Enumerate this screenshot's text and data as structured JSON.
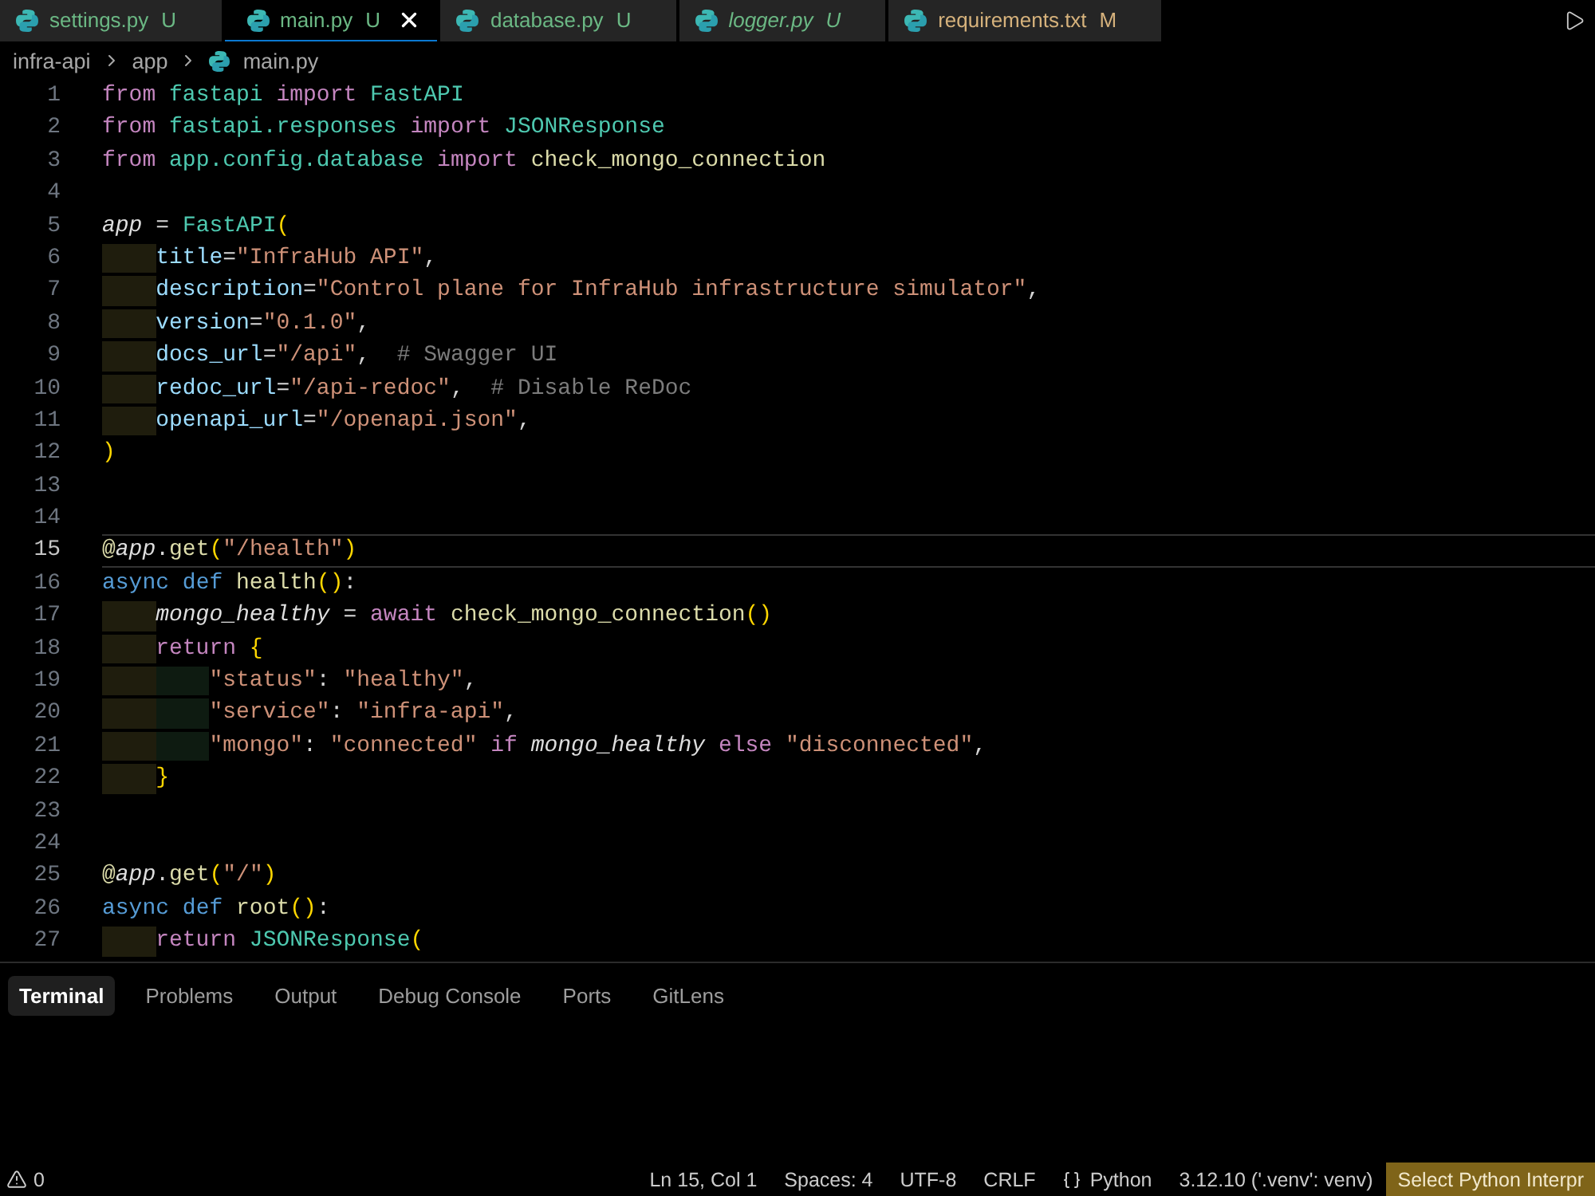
{
  "tabs": [
    {
      "name": "settings.py",
      "status": "U",
      "color": "#6bb884",
      "selected": false,
      "preview": false
    },
    {
      "name": "main.py",
      "status": "U",
      "color": "#6bb884",
      "selected": true,
      "preview": false
    },
    {
      "name": "database.py",
      "status": "U",
      "color": "#6bb884",
      "selected": false,
      "preview": false
    },
    {
      "name": "logger.py",
      "status": "U",
      "color": "#6bb884",
      "selected": false,
      "preview": true
    },
    {
      "name": "requirements.txt",
      "status": "M",
      "color": "#d6b27c",
      "selected": false,
      "preview": false
    }
  ],
  "breadcrumb": [
    {
      "label": "infra-api",
      "kind": "folder"
    },
    {
      "label": "app",
      "kind": "folder"
    },
    {
      "label": "main.py",
      "kind": "file"
    }
  ],
  "editor": {
    "lines": [
      {
        "number": "1",
        "current": false,
        "tokens": [
          {
            "text": "from",
            "kind": "keyword"
          },
          {
            "text": " fastapi",
            "kind": "type"
          },
          {
            "text": " import",
            "kind": "keyword"
          },
          {
            "text": " FastAPI",
            "kind": "type"
          }
        ]
      },
      {
        "number": "2",
        "current": false,
        "tokens": [
          {
            "text": "from",
            "kind": "keyword"
          },
          {
            "text": " fastapi.responses",
            "kind": "type"
          },
          {
            "text": " import",
            "kind": "keyword"
          },
          {
            "text": " JSONResponse",
            "kind": "type"
          }
        ]
      },
      {
        "number": "3",
        "current": false,
        "tokens": [
          {
            "text": "from",
            "kind": "keyword"
          },
          {
            "text": " app.config.database",
            "kind": "type"
          },
          {
            "text": " import",
            "kind": "keyword"
          },
          {
            "text": " check_mongo_connection",
            "kind": "function"
          }
        ]
      },
      {
        "number": "4",
        "current": false
      },
      {
        "number": "5",
        "current": false,
        "tokens": [
          {
            "text": "app",
            "kind": "variable"
          },
          {
            "text": " = ",
            "kind": "plain"
          },
          {
            "text": "FastAPI",
            "kind": "type"
          },
          {
            "text": "(",
            "kind": "bracket"
          }
        ]
      },
      {
        "number": "6",
        "current": false,
        "guides": [
          {
            "color": "#1f1d0d"
          }
        ],
        "tokens": [
          {
            "text": "title",
            "kind": "param"
          },
          {
            "text": "=",
            "kind": "plain"
          },
          {
            "text": "\"InfraHub API\"",
            "kind": "string"
          },
          {
            "text": ",",
            "kind": "plain"
          }
        ]
      },
      {
        "number": "7",
        "current": false,
        "guides": [
          {
            "color": "#1f1d0d"
          }
        ],
        "tokens": [
          {
            "text": "description",
            "kind": "param"
          },
          {
            "text": "=",
            "kind": "plain"
          },
          {
            "text": "\"Control plane for InfraHub infrastructure simulator\"",
            "kind": "string"
          },
          {
            "text": ",",
            "kind": "plain"
          }
        ]
      },
      {
        "number": "8",
        "current": false,
        "guides": [
          {
            "color": "#1f1d0d"
          }
        ],
        "tokens": [
          {
            "text": "version",
            "kind": "param"
          },
          {
            "text": "=",
            "kind": "plain"
          },
          {
            "text": "\"0.1.0\"",
            "kind": "string"
          },
          {
            "text": ",",
            "kind": "plain"
          }
        ]
      },
      {
        "number": "9",
        "current": false,
        "guides": [
          {
            "color": "#1f1d0d"
          }
        ],
        "tokens": [
          {
            "text": "docs_url",
            "kind": "param"
          },
          {
            "text": "=",
            "kind": "plain"
          },
          {
            "text": "\"/api\"",
            "kind": "string"
          },
          {
            "text": ",",
            "kind": "plain"
          },
          {
            "text": "  # Swagger UI",
            "kind": "comment"
          }
        ]
      },
      {
        "number": "10",
        "current": false,
        "guides": [
          {
            "color": "#1f1d0d"
          }
        ],
        "tokens": [
          {
            "text": "redoc_url",
            "kind": "param"
          },
          {
            "text": "=",
            "kind": "plain"
          },
          {
            "text": "\"/api-redoc\"",
            "kind": "string"
          },
          {
            "text": ",",
            "kind": "plain"
          },
          {
            "text": "  # Disable ReDoc",
            "kind": "comment"
          }
        ]
      },
      {
        "number": "11",
        "current": false,
        "guides": [
          {
            "color": "#1f1d0d"
          }
        ],
        "tokens": [
          {
            "text": "openapi_url",
            "kind": "param"
          },
          {
            "text": "=",
            "kind": "plain"
          },
          {
            "text": "\"/openapi.json\"",
            "kind": "string"
          },
          {
            "text": ",",
            "kind": "plain"
          }
        ]
      },
      {
        "number": "12",
        "current": false,
        "tokens": [
          {
            "text": ")",
            "kind": "bracket"
          }
        ]
      },
      {
        "number": "13",
        "current": false
      },
      {
        "number": "14",
        "current": false
      },
      {
        "number": "15",
        "current": true,
        "tokens": [
          {
            "text": "@",
            "kind": "decorator"
          },
          {
            "text": "app",
            "kind": "variable"
          },
          {
            "text": ".",
            "kind": "plain"
          },
          {
            "text": "get",
            "kind": "function"
          },
          {
            "text": "(",
            "kind": "bracket"
          },
          {
            "text": "\"/health\"",
            "kind": "string"
          },
          {
            "text": ")",
            "kind": "bracket"
          }
        ]
      },
      {
        "number": "16",
        "current": false,
        "tokens": [
          {
            "text": "async",
            "kind": "storage"
          },
          {
            "text": " def",
            "kind": "storage"
          },
          {
            "text": " health",
            "kind": "function"
          },
          {
            "text": "()",
            "kind": "bracket"
          },
          {
            "text": ":",
            "kind": "plain"
          }
        ]
      },
      {
        "number": "17",
        "current": false,
        "guides": [
          {
            "color": "#1f1d0d"
          }
        ],
        "tokens": [
          {
            "text": "mongo_healthy",
            "kind": "variable"
          },
          {
            "text": " = ",
            "kind": "plain"
          },
          {
            "text": "await",
            "kind": "keyword"
          },
          {
            "text": " check_mongo_connection",
            "kind": "function"
          },
          {
            "text": "()",
            "kind": "bracket"
          }
        ]
      },
      {
        "number": "18",
        "current": false,
        "guides": [
          {
            "color": "#1f1d0d"
          }
        ],
        "tokens": [
          {
            "text": "return",
            "kind": "keyword"
          },
          {
            "text": " {",
            "kind": "bracket"
          }
        ]
      },
      {
        "number": "19",
        "current": false,
        "guides": [
          {
            "color": "#1f1d0d"
          },
          {
            "color": "#0e1b11"
          }
        ],
        "tokens": [
          {
            "text": "\"status\"",
            "kind": "string"
          },
          {
            "text": ": ",
            "kind": "plain"
          },
          {
            "text": "\"healthy\"",
            "kind": "string"
          },
          {
            "text": ",",
            "kind": "plain"
          }
        ]
      },
      {
        "number": "20",
        "current": false,
        "guides": [
          {
            "color": "#1f1d0d"
          },
          {
            "color": "#0e1b11"
          }
        ],
        "tokens": [
          {
            "text": "\"service\"",
            "kind": "string"
          },
          {
            "text": ": ",
            "kind": "plain"
          },
          {
            "text": "\"infra-api\"",
            "kind": "string"
          },
          {
            "text": ",",
            "kind": "plain"
          }
        ]
      },
      {
        "number": "21",
        "current": false,
        "guides": [
          {
            "color": "#1f1d0d"
          },
          {
            "color": "#0e1b11"
          }
        ],
        "tokens": [
          {
            "text": "\"mongo\"",
            "kind": "string"
          },
          {
            "text": ": ",
            "kind": "plain"
          },
          {
            "text": "\"connected\"",
            "kind": "string"
          },
          {
            "text": " if",
            "kind": "keyword"
          },
          {
            "text": " mongo_healthy",
            "kind": "variable"
          },
          {
            "text": " else",
            "kind": "keyword"
          },
          {
            "text": " \"disconnected\"",
            "kind": "string"
          },
          {
            "text": ",",
            "kind": "plain"
          }
        ]
      },
      {
        "number": "22",
        "current": false,
        "guides": [
          {
            "color": "#1f1d0d"
          }
        ],
        "tokens": [
          {
            "text": "}",
            "kind": "bracket"
          }
        ]
      },
      {
        "number": "23",
        "current": false
      },
      {
        "number": "24",
        "current": false
      },
      {
        "number": "25",
        "current": false,
        "tokens": [
          {
            "text": "@",
            "kind": "decorator"
          },
          {
            "text": "app",
            "kind": "variable"
          },
          {
            "text": ".",
            "kind": "plain"
          },
          {
            "text": "get",
            "kind": "function"
          },
          {
            "text": "(",
            "kind": "bracket"
          },
          {
            "text": "\"/\"",
            "kind": "string"
          },
          {
            "text": ")",
            "kind": "bracket"
          }
        ]
      },
      {
        "number": "26",
        "current": false,
        "tokens": [
          {
            "text": "async",
            "kind": "storage"
          },
          {
            "text": " def",
            "kind": "storage"
          },
          {
            "text": " root",
            "kind": "function"
          },
          {
            "text": "()",
            "kind": "bracket"
          },
          {
            "text": ":",
            "kind": "plain"
          }
        ]
      },
      {
        "number": "27",
        "current": false,
        "guides": [
          {
            "color": "#1f1d0d"
          }
        ],
        "tokens": [
          {
            "text": "return",
            "kind": "keyword"
          },
          {
            "text": " JSONResponse",
            "kind": "type"
          },
          {
            "text": "(",
            "kind": "bracket"
          }
        ]
      }
    ]
  },
  "panel": {
    "tabs": [
      {
        "label": "Terminal",
        "selected": true
      },
      {
        "label": "Problems",
        "selected": false
      },
      {
        "label": "Output",
        "selected": false
      },
      {
        "label": "Debug Console",
        "selected": false
      },
      {
        "label": "Ports",
        "selected": false
      },
      {
        "label": "GitLens",
        "selected": false
      }
    ]
  },
  "status_bar": {
    "problems": "0",
    "items": [
      {
        "text": "Ln 15, Col 1",
        "kind": "plain"
      },
      {
        "text": "Spaces: 4",
        "kind": "plain"
      },
      {
        "text": "UTF-8",
        "kind": "plain"
      },
      {
        "text": "CRLF",
        "kind": "plain"
      },
      {
        "text": "Python",
        "kind": "language"
      },
      {
        "text": "3.12.10 ('.venv': venv)",
        "kind": "plain"
      },
      {
        "text": "Select Python Interpr",
        "kind": "accent"
      }
    ]
  }
}
